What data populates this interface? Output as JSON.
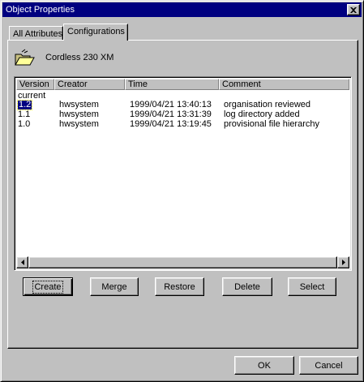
{
  "window": {
    "title": "Object Properties",
    "close_icon": "close-x-icon"
  },
  "tabs": [
    {
      "label": "All Attributes",
      "active": false
    },
    {
      "label": "Configurations",
      "active": true
    }
  ],
  "object": {
    "icon": "open-folder-icon",
    "name": "Cordless 230 XM"
  },
  "list": {
    "columns": [
      "Version",
      "Creator",
      "Time",
      "Comment"
    ],
    "current_label": "current",
    "rows": [
      {
        "version": "1.2",
        "creator": "hwsystem",
        "time": "1999/04/21 13:40:13",
        "comment": "organisation reviewed",
        "selected": true
      },
      {
        "version": "1.1",
        "creator": "hwsystem",
        "time": "1999/04/21 13:31:39",
        "comment": "log directory added",
        "selected": false
      },
      {
        "version": "1.0",
        "creator": "hwsystem",
        "time": "1999/04/21 13:19:45",
        "comment": "provisional file hierarchy",
        "selected": false
      }
    ]
  },
  "actions": {
    "create": "Create",
    "merge": "Merge",
    "restore": "Restore",
    "delete": "Delete",
    "select": "Select"
  },
  "footer": {
    "ok": "OK",
    "cancel": "Cancel"
  },
  "colors": {
    "titlebar": "#000080",
    "face": "#c0c0c0",
    "selection": "#000080"
  }
}
